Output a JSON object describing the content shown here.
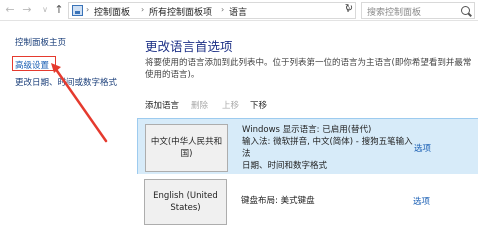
{
  "address_bar": {
    "back_icon": "arrow-left-icon",
    "forward_icon": "arrow-right-icon",
    "breadcrumbs": [
      "控制面板",
      "所有控制面板项",
      "语言"
    ],
    "search_placeholder": "搜索控制面板"
  },
  "sidebar": {
    "items": [
      {
        "label": "控制面板主页"
      },
      {
        "label": "高级设置"
      },
      {
        "label": "更改日期、时间或数字格式"
      }
    ]
  },
  "main": {
    "title": "更改语言首选项",
    "description": "将要使用的语言添加到此列表中。位于列表第一位的语言为主语言(即你希望看到并最常使用的语言)。",
    "toolbar": {
      "add": "添加语言",
      "remove": "删除",
      "up": "上移",
      "down": "下移"
    },
    "languages": [
      {
        "name": "中文(中华人民共和国)",
        "details": [
          "Windows 显示语言: 已启用(替代)",
          "输入法: 微软拼音, 中文(简体) - 搜狗五笔输入法",
          "日期、时间和数字格式"
        ],
        "options": "选项"
      },
      {
        "name": "English (United States)",
        "details": [
          "键盘布局: 美式键盘"
        ],
        "options": "选项"
      }
    ]
  },
  "colors": {
    "title": "#1e3287",
    "link": "#1a5fb4",
    "selected_row": "#d7ebf9",
    "annotation": "#e53a2e"
  }
}
